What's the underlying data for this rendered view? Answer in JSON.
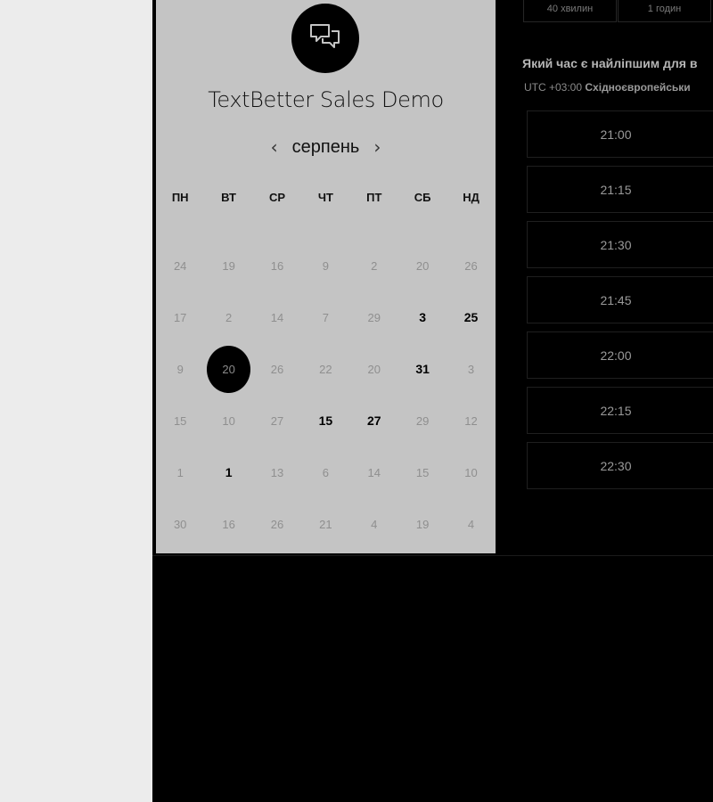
{
  "brand": {
    "title": "TextBetter Sales Demo",
    "logo_icon": "chat-bubbles-icon"
  },
  "calendar": {
    "prev_label": "‹",
    "next_label": "›",
    "month": "серпень",
    "weekdays": [
      "ПН",
      "ВТ",
      "СР",
      "ЧТ",
      "ПТ",
      "СБ",
      "НД"
    ],
    "rows": [
      [
        {
          "d": "24",
          "s": "disabled"
        },
        {
          "d": "19",
          "s": "disabled"
        },
        {
          "d": "16",
          "s": "disabled"
        },
        {
          "d": "9",
          "s": "disabled"
        },
        {
          "d": "2",
          "s": "disabled"
        },
        {
          "d": "20",
          "s": "disabled"
        },
        {
          "d": "26",
          "s": "disabled"
        }
      ],
      [
        {
          "d": "17",
          "s": "disabled"
        },
        {
          "d": "2",
          "s": "disabled"
        },
        {
          "d": "14",
          "s": "disabled"
        },
        {
          "d": "7",
          "s": "disabled"
        },
        {
          "d": "29",
          "s": "disabled"
        },
        {
          "d": "3",
          "s": "available"
        },
        {
          "d": "25",
          "s": "available"
        }
      ],
      [
        {
          "d": "9",
          "s": "disabled"
        },
        {
          "d": "20",
          "s": "selected"
        },
        {
          "d": "26",
          "s": "disabled"
        },
        {
          "d": "22",
          "s": "disabled"
        },
        {
          "d": "20",
          "s": "disabled"
        },
        {
          "d": "31",
          "s": "available"
        },
        {
          "d": "3",
          "s": "disabled"
        }
      ],
      [
        {
          "d": "15",
          "s": "disabled"
        },
        {
          "d": "10",
          "s": "disabled"
        },
        {
          "d": "27",
          "s": "disabled"
        },
        {
          "d": "15",
          "s": "available"
        },
        {
          "d": "27",
          "s": "available"
        },
        {
          "d": "29",
          "s": "disabled"
        },
        {
          "d": "12",
          "s": "disabled"
        }
      ],
      [
        {
          "d": "1",
          "s": "disabled"
        },
        {
          "d": "1",
          "s": "available"
        },
        {
          "d": "13",
          "s": "disabled"
        },
        {
          "d": "6",
          "s": "disabled"
        },
        {
          "d": "14",
          "s": "disabled"
        },
        {
          "d": "15",
          "s": "disabled"
        },
        {
          "d": "10",
          "s": "disabled"
        }
      ],
      [
        {
          "d": "30",
          "s": "disabled"
        },
        {
          "d": "16",
          "s": "disabled"
        },
        {
          "d": "26",
          "s": "disabled"
        },
        {
          "d": "21",
          "s": "disabled"
        },
        {
          "d": "4",
          "s": "disabled"
        },
        {
          "d": "19",
          "s": "disabled"
        },
        {
          "d": "4",
          "s": "disabled"
        }
      ]
    ]
  },
  "scheduler": {
    "durations": [
      "40 хвилин",
      "1 годин"
    ],
    "question": "Який час є найліпшим для в",
    "timezone_prefix": "UTC +03:00",
    "timezone_name": "Східноєвропейськи",
    "slots": [
      "21:00",
      "21:15",
      "21:30",
      "21:45",
      "22:00",
      "22:15",
      "22:30"
    ]
  },
  "colors": {
    "panel_bg": "#c4c4c4",
    "page_bg": "#ececec",
    "dark_bg": "#000000"
  }
}
